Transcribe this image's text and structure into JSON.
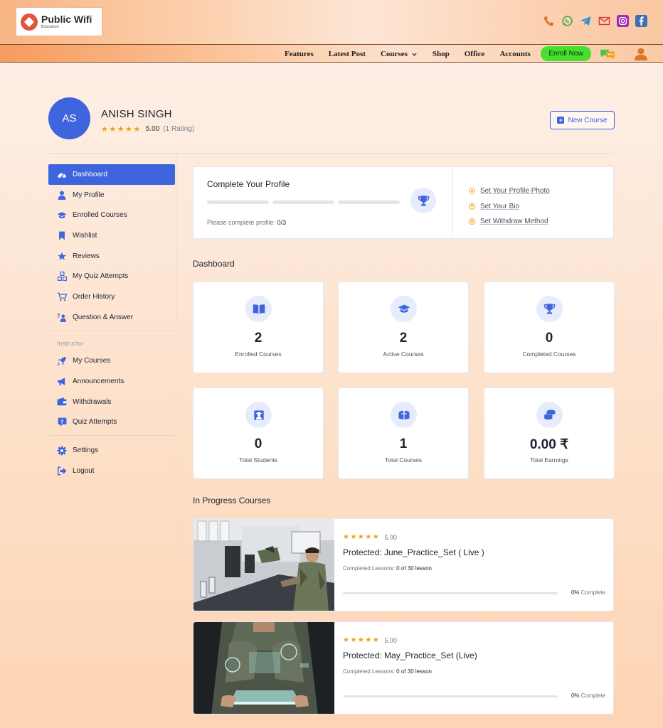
{
  "brand": {
    "name": "Public Wifi",
    "tagline": "Education"
  },
  "colors": {
    "accent": "#3e64de",
    "star": "#f0a113",
    "enroll": "#46e02f"
  },
  "header_icons": [
    "phone-icon",
    "whatsapp-icon",
    "telegram-icon",
    "mail-icon",
    "instagram-icon",
    "facebook-icon"
  ],
  "nav": {
    "items": [
      "Features",
      "Latest Post",
      "Courses",
      "Shop",
      "Office",
      "Accounts"
    ],
    "enroll_label": "Enroll Now"
  },
  "profile": {
    "initials": "AS",
    "name": "ANISH SINGH",
    "stars": "★★★★★",
    "rating": "5.00",
    "rating_count": "(1 Rating)",
    "new_course_label": "New Course"
  },
  "sidebar": {
    "items": [
      {
        "label": "Dashboard",
        "icon": "dashboard-icon"
      },
      {
        "label": "My Profile",
        "icon": "user-icon"
      },
      {
        "label": "Enrolled Courses",
        "icon": "graduation-cap-icon"
      },
      {
        "label": "Wishlist",
        "icon": "bookmark-icon"
      },
      {
        "label": "Reviews",
        "icon": "star-icon"
      },
      {
        "label": "My Quiz Attempts",
        "icon": "quiz-icon"
      },
      {
        "label": "Order History",
        "icon": "cart-icon"
      },
      {
        "label": "Question & Answer",
        "icon": "question-icon"
      }
    ],
    "instructor_heading": "Instructor",
    "instructor_items": [
      {
        "label": "My Courses",
        "icon": "rocket-icon"
      },
      {
        "label": "Announcements",
        "icon": "megaphone-icon"
      },
      {
        "label": "Withdrawals",
        "icon": "wallet-icon"
      },
      {
        "label": "Quiz Attempts",
        "icon": "quiz-question-icon"
      }
    ],
    "footer_items": [
      {
        "label": "Settings",
        "icon": "gear-icon"
      },
      {
        "label": "Logout",
        "icon": "logout-icon"
      }
    ]
  },
  "complete_profile": {
    "title": "Complete Your Profile",
    "note_prefix": "Please complete profile:",
    "note_value": "0/3",
    "completed_steps": 0,
    "total_steps": 3,
    "links": [
      "Set Your Profile Photo",
      "Set Your Bio",
      "Set Withdraw Method"
    ]
  },
  "dashboard": {
    "title": "Dashboard",
    "stats": [
      {
        "value": "2",
        "label": "Enrolled Courses",
        "icon": "book-open-icon"
      },
      {
        "value": "2",
        "label": "Active Courses",
        "icon": "graduation-cap-icon"
      },
      {
        "value": "0",
        "label": "Completed Courses",
        "icon": "trophy-icon"
      },
      {
        "value": "0",
        "label": "Total Students",
        "icon": "student-icon"
      },
      {
        "value": "1",
        "label": "Total Courses",
        "icon": "boxes-icon"
      },
      {
        "value": "0.00 ₹",
        "label": "Total Earnings",
        "icon": "coins-icon"
      }
    ]
  },
  "in_progress": {
    "title": "In Progress Courses",
    "courses": [
      {
        "stars": "★★★★★",
        "rating": "5.00",
        "title": "Protected: June_Practice_Set ( Live )",
        "lessons_prefix": "Completed Lessons:",
        "lessons_value": "0 of 30 lesson",
        "progress": 0,
        "pct_value": "0%",
        "pct_label": "Complete"
      },
      {
        "stars": "★★★★★",
        "rating": "5.00",
        "title": "Protected: May_Practice_Set (Live)",
        "lessons_prefix": "Completed Lessons:",
        "lessons_value": "0 of 30 lesson",
        "progress": 0,
        "pct_value": "0%",
        "pct_label": "Complete"
      }
    ]
  }
}
